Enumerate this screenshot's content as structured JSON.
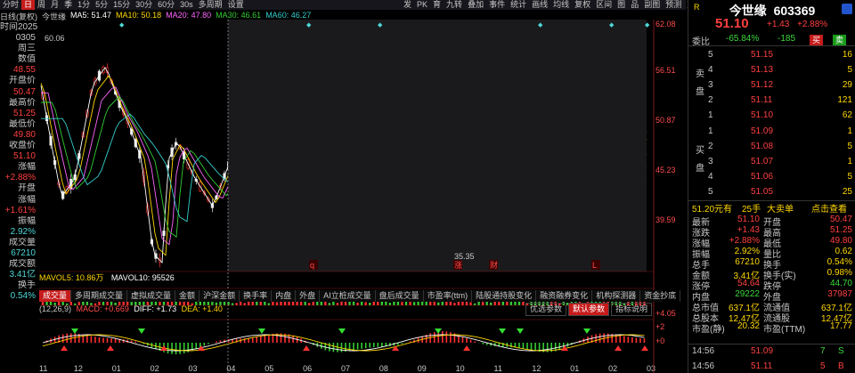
{
  "topbar": {
    "tabs": [
      "分时",
      "日",
      "周",
      "月",
      "季",
      "1分",
      "5分",
      "15分",
      "30分",
      "60分",
      "30s",
      "多周期",
      "设置"
    ],
    "active_index": 1,
    "right_tabs": [
      "发",
      "PK",
      "育",
      "九转",
      "叠加",
      "事件",
      "统计",
      "画线",
      "均线",
      "复权",
      "区间",
      "图",
      "品",
      "副图",
      "预测",
      "蓝字",
      "◀▶"
    ]
  },
  "ma_legend": {
    "mode": "日线(复权)",
    "name": "今世缘",
    "ma5": "MA5: 51.47",
    "ma10": "MA10: 50.18",
    "ma20": "MA20: 47.80",
    "ma30": "MA30: 46.61",
    "ma60": "MA60: 46.27"
  },
  "left_info": [
    {
      "label": "时间",
      "value": "2025",
      "cls": "lbl"
    },
    {
      "label": "",
      "value": "0305",
      "cls": "lbl"
    },
    {
      "label": "",
      "value": "周三",
      "cls": "lbl"
    },
    {
      "label": "数值",
      "value": "",
      "cls": "lbl"
    },
    {
      "label": "",
      "value": "48.55",
      "cls": "val-red"
    },
    {
      "label": "开盘价",
      "value": "",
      "cls": "lbl"
    },
    {
      "label": "",
      "value": "50.47",
      "cls": "val-red"
    },
    {
      "label": "最高价",
      "value": "",
      "cls": "lbl"
    },
    {
      "label": "",
      "value": "51.25",
      "cls": "val-red"
    },
    {
      "label": "最低价",
      "value": "",
      "cls": "lbl"
    },
    {
      "label": "",
      "value": "49.80",
      "cls": "val-red"
    },
    {
      "label": "收盘价",
      "value": "",
      "cls": "lbl"
    },
    {
      "label": "",
      "value": "51.10",
      "cls": "val-red"
    },
    {
      "label": "涨幅",
      "value": "",
      "cls": "lbl"
    },
    {
      "label": "",
      "value": "+2.88%",
      "cls": "val-red"
    },
    {
      "label": "开盘",
      "value": "",
      "cls": "lbl"
    },
    {
      "label": "涨幅",
      "value": "",
      "cls": "lbl"
    },
    {
      "label": "",
      "value": "+1.61%",
      "cls": "val-red"
    },
    {
      "label": "振幅",
      "value": "",
      "cls": "lbl"
    },
    {
      "label": "",
      "value": "2.92%",
      "cls": "val-cyan"
    },
    {
      "label": "成交量",
      "value": "",
      "cls": "lbl"
    },
    {
      "label": "",
      "value": "67210",
      "cls": "val-cyan"
    },
    {
      "label": "成交额",
      "value": "",
      "cls": "lbl"
    },
    {
      "label": "",
      "value": "3.41亿",
      "cls": "val-cyan"
    },
    {
      "label": "换手",
      "value": "",
      "cls": "lbl"
    },
    {
      "label": "",
      "value": "0.54%",
      "cls": "val-cyan"
    }
  ],
  "chart": {
    "hi_label": "62.08",
    "lo_label": "35.35",
    "left_price": "60.06",
    "right_axis": [
      "62.08",
      "56.51",
      "50.87",
      "45.23",
      "39.59"
    ],
    "macd_axis": [
      "+4.05",
      "+2",
      "+0"
    ],
    "markers": [
      "q",
      "涨",
      "财",
      "L"
    ],
    "x_months": [
      "11",
      "12",
      "01",
      "02",
      "03",
      "04",
      "05",
      "06",
      "07",
      "08",
      "09",
      "10",
      "11",
      "12",
      "01",
      "02",
      "03"
    ]
  },
  "vol_legend": {
    "mavol5": "MAVOL5: 10.86万",
    "mavol10": "MAVOL10: 95526"
  },
  "macd_legend": {
    "name": "(12,26,9)",
    "macd": "MACD: +0.669",
    "diff": "DIFF: +1.73",
    "dea": "DEA: +1.40"
  },
  "ind_tabs": [
    "成交量",
    "多周期成交量",
    "虚拟成交量",
    "金额",
    "沪深金额",
    "换手率",
    "内盘",
    "外盘",
    "AI立桩成交量",
    "盘后成交量",
    "市盈率(ttm)",
    "陆股通持股变化",
    "融资融券变化",
    "机构探测器",
    "资金抄底"
  ],
  "ind_sub_tabs": [
    "优选参数",
    "默认参数",
    "指标说明"
  ],
  "right_panel": {
    "title": "今世缘",
    "code": "603369",
    "price": "51.10",
    "change": "+1.43",
    "change_pct": "+2.88%",
    "weibi_label": "委比",
    "weibi": "-65.84%",
    "weicha": "-185",
    "buy_btn": "买",
    "sell_btn": "卖",
    "asks": [
      {
        "level": "5",
        "price": "51.15",
        "vol": "16"
      },
      {
        "level": "4",
        "price": "51.13",
        "vol": "5"
      },
      {
        "level": "3",
        "price": "51.12",
        "vol": "29"
      },
      {
        "level": "2",
        "price": "51.11",
        "vol": "121"
      },
      {
        "level": "1",
        "price": "51.10",
        "vol": "62"
      }
    ],
    "bids": [
      {
        "level": "1",
        "price": "51.09",
        "vol": "1"
      },
      {
        "level": "2",
        "price": "51.08",
        "vol": "5"
      },
      {
        "level": "3",
        "price": "51.07",
        "vol": "1"
      },
      {
        "level": "4",
        "price": "51.06",
        "vol": "5"
      },
      {
        "level": "5",
        "price": "51.05",
        "vol": "25"
      }
    ],
    "ask_side_label": "卖盘",
    "bid_side_label": "买盘",
    "bigorder": "51.20元有",
    "bigorder_vol": "25手",
    "bigorder_type": "大卖单",
    "bigorder_link": "点击查看",
    "stats": [
      [
        "最新",
        "51.10",
        "开盘",
        "50.47"
      ],
      [
        "涨跌",
        "+1.43",
        "最高",
        "51.25"
      ],
      [
        "涨幅",
        "+2.88%",
        "最低",
        "49.80"
      ],
      [
        "振幅",
        "2.92%",
        "量比",
        "0.62"
      ],
      [
        "总手",
        "67210",
        "换手",
        "0.54%"
      ],
      [
        "金额",
        "3.41亿",
        "换手(实)",
        "0.98%"
      ],
      [
        "涨停",
        "54.64",
        "跌停",
        "44.70"
      ],
      [
        "内盘",
        "29222",
        "外盘",
        "37987"
      ],
      [
        "总市值",
        "637.1亿",
        "流通值",
        "637.1亿"
      ],
      [
        "总股本",
        "12.47亿",
        "流通股",
        "12.47亿"
      ],
      [
        "市盈(静)",
        "20.32",
        "市盈(TTM)",
        "17.77"
      ]
    ],
    "ticks": [
      {
        "time": "14:56",
        "price": "51.09",
        "vol": "7",
        "dir": "S"
      },
      {
        "time": "14:56",
        "price": "51.11",
        "vol": "5",
        "dir": "B"
      }
    ],
    "colors": {
      "up": "#ff4040",
      "down": "#3cd83c",
      "yellow": "#ffd700"
    }
  }
}
